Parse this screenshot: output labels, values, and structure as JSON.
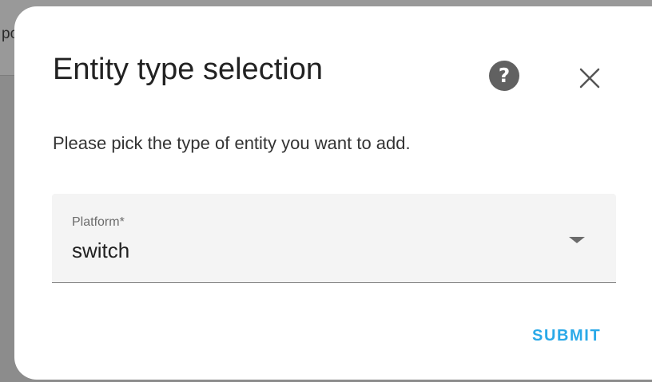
{
  "background": {
    "fragment_text": "pc"
  },
  "dialog": {
    "title": "Entity type selection",
    "help_button_label": "?",
    "description": "Please pick the type of entity you want to add.",
    "platform_field": {
      "label": "Platform*",
      "value": "switch"
    },
    "submit_label": "SUBMIT"
  },
  "colors": {
    "accent": "#2aa9e8",
    "help_icon_bg": "#616161",
    "overlay": "#8c8c8c"
  },
  "icons": {
    "help": "help-circle-icon",
    "close": "close-icon",
    "dropdown": "dropdown-arrow-icon"
  }
}
